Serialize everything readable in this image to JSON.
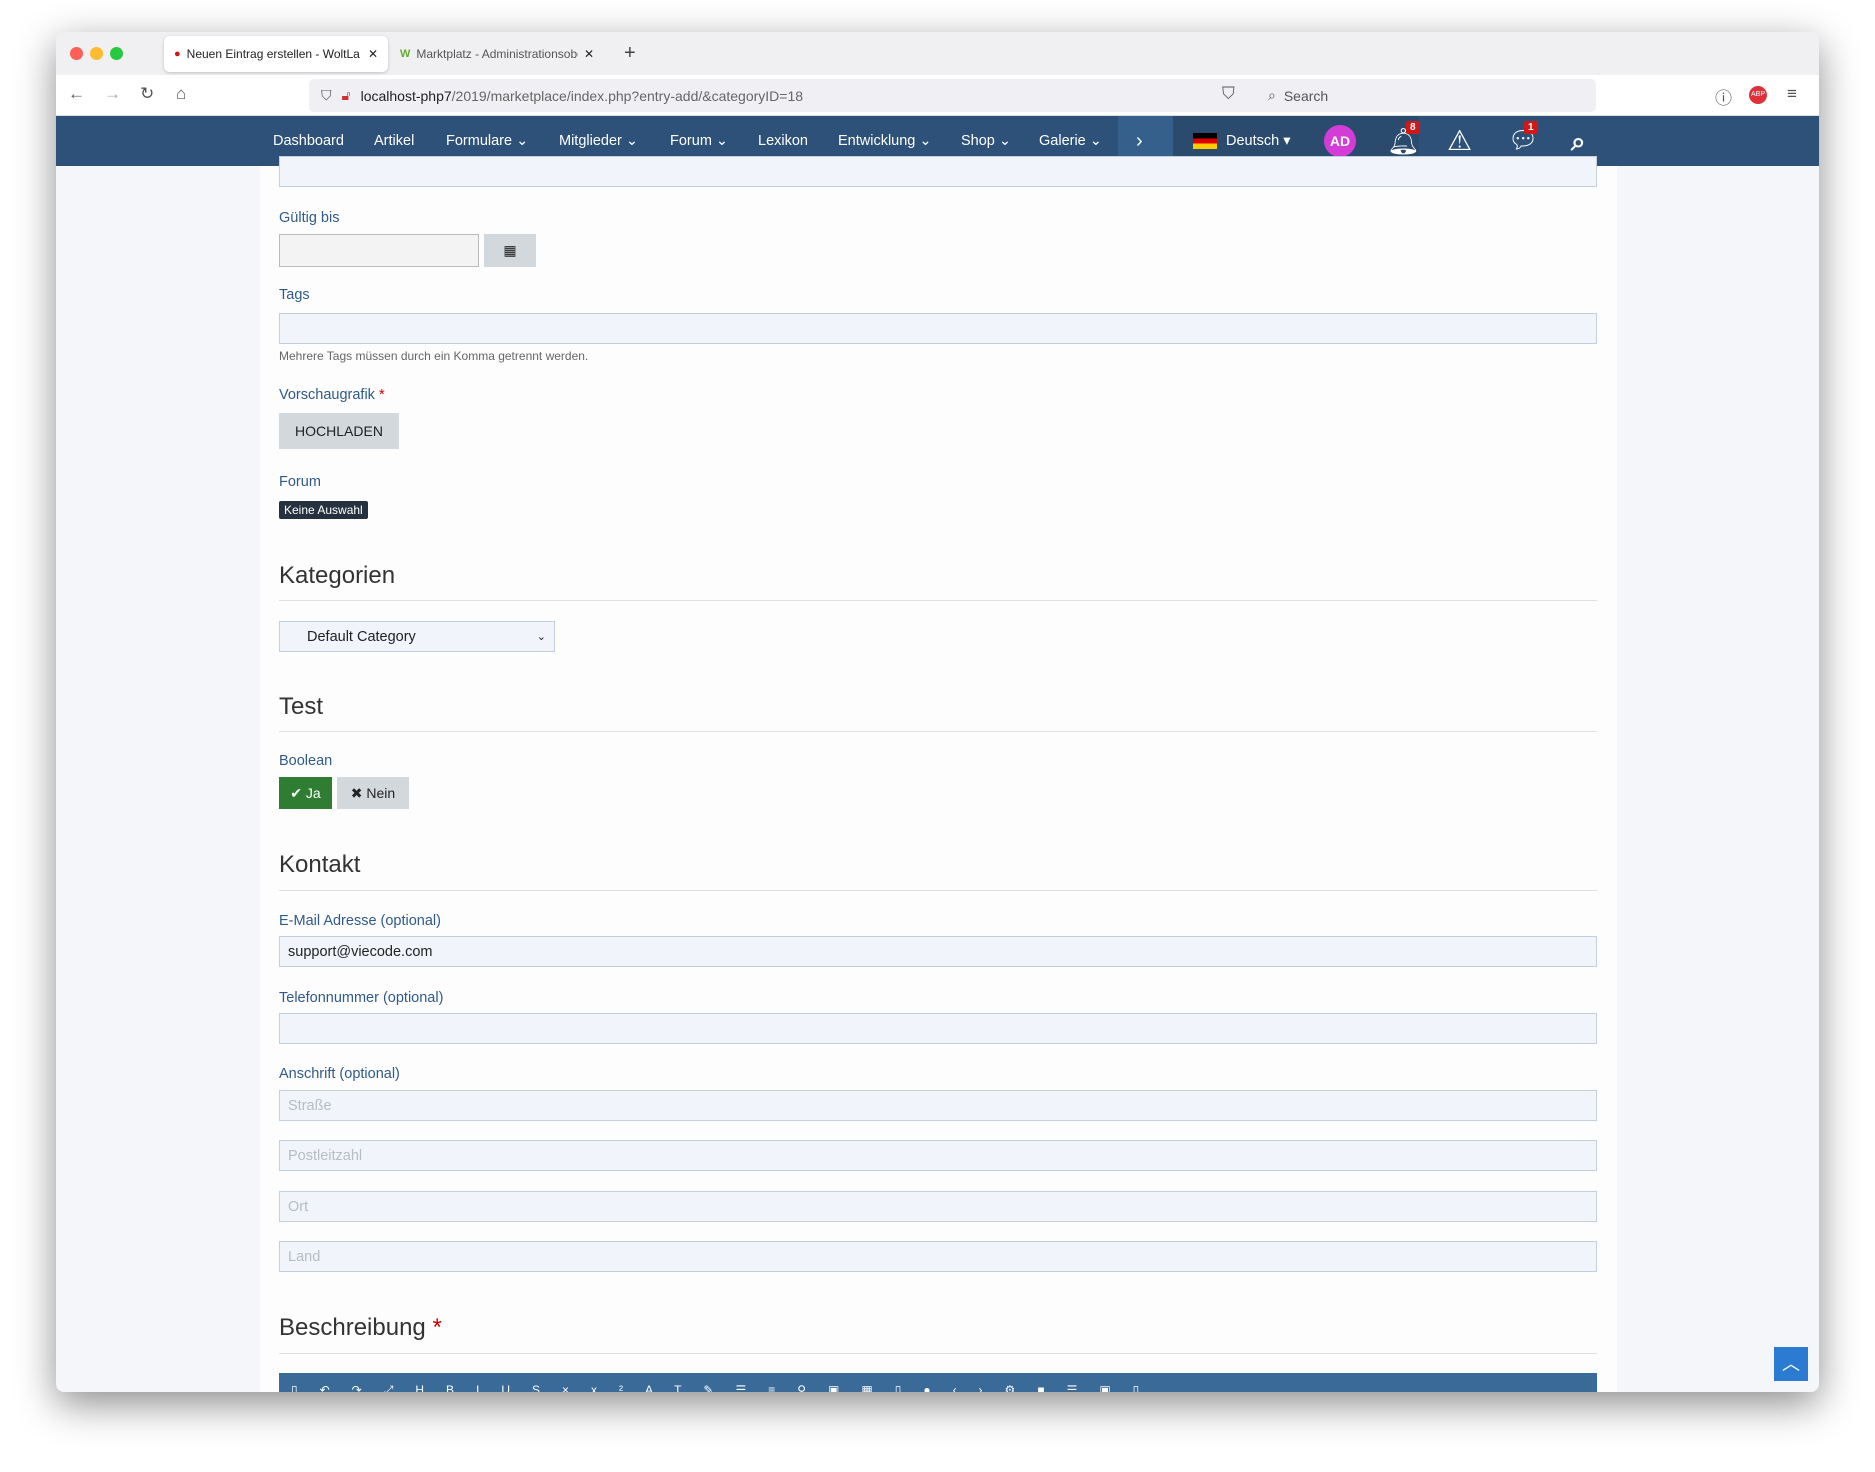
{
  "browser": {
    "tabs": [
      {
        "title": "Neuen Eintrag erstellen - WoltLa"
      },
      {
        "title": "Marktplatz - Administrationsobe"
      }
    ],
    "url_host": "localhost-php7",
    "url_path": "/2019/marketplace/index.php?entry-add/&categoryID=18",
    "search_placeholder": "Search",
    "tab_badge": "8"
  },
  "nav": {
    "items": [
      "Dashboard",
      "Artikel",
      "Formulare",
      "Mitglieder",
      "Forum",
      "Lexikon",
      "Entwicklung",
      "Shop",
      "Galerie"
    ],
    "language": "Deutsch",
    "avatar": "AD",
    "notifications_count": "8",
    "messages_count": "1"
  },
  "form": {
    "valid_until_label": "Gültig bis",
    "tags_label": "Tags",
    "tags_help": "Mehrere Tags müssen durch ein Komma getrennt werden.",
    "preview_label": "Vorschaugrafik",
    "required_mark": "*",
    "upload_button": "HOCHLADEN",
    "forum_label": "Forum",
    "forum_value": "Keine Auswahl",
    "categories_heading": "Kategorien",
    "category_selected": "Default Category",
    "test_heading": "Test",
    "boolean_label": "Boolean",
    "yes_label": "Ja",
    "no_label": "Nein",
    "contact_heading": "Kontakt",
    "email_label": "E-Mail Adresse (optional)",
    "email_value": "support@viecode.com",
    "phone_label": "Telefonnummer (optional)",
    "address_label": "Anschrift (optional)",
    "street_placeholder": "Straße",
    "zip_placeholder": "Postleitzahl",
    "city_placeholder": "Ort",
    "country_placeholder": "Land",
    "description_heading": "Beschreibung"
  }
}
